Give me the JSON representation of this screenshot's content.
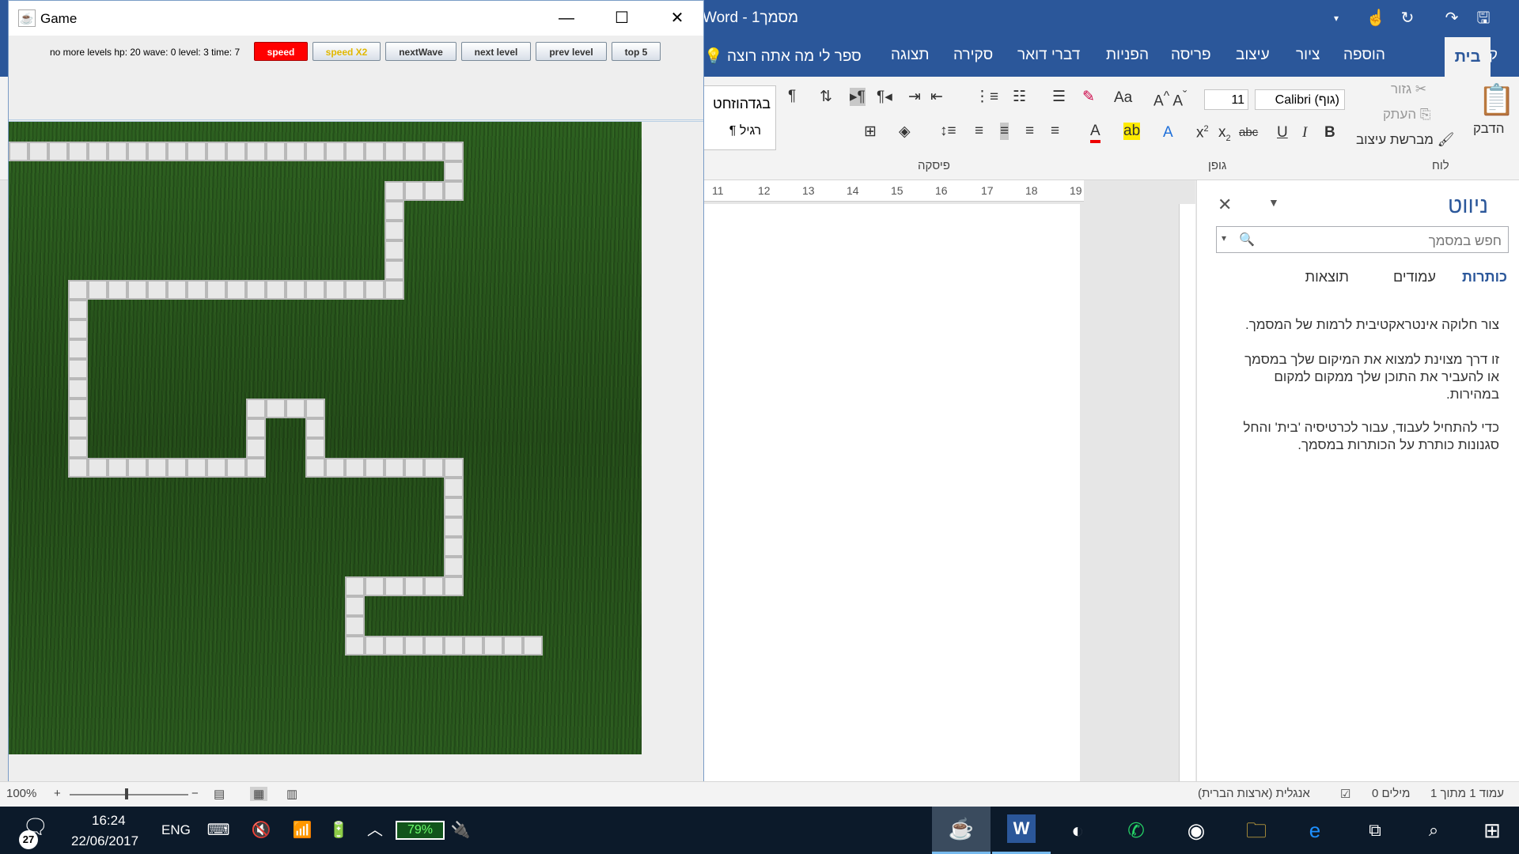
{
  "word": {
    "title": "Word - מסמך1",
    "quick_access": [
      "save-icon",
      "redo-icon",
      "refresh-icon",
      "touch-icon",
      "dropdown-icon"
    ],
    "tabs": [
      "קובץ",
      "בית",
      "הוספה",
      "ציור",
      "עיצוב",
      "פריסה",
      "הפניות",
      "דברי דואר",
      "סקירה",
      "תצוגה"
    ],
    "tell_me": "ספר לי מה אתה רוצה",
    "ribbon": {
      "clipboard_label": "לוח",
      "paste_label": "הדבק",
      "cut_label": "גזור",
      "copy_label": "העתק",
      "format_painter_label": "מברשת עיצוב",
      "font_label": "גופן",
      "font_name": "Calibri (גוף)",
      "font_size": "11",
      "paragraph_label": "פיסקה",
      "style_heading": "בגדהוזחט",
      "style_normal": "¶ רגיל"
    },
    "ruler_numbers": [
      "11",
      "12",
      "13",
      "14",
      "15",
      "16",
      "17",
      "18",
      "19"
    ],
    "nav_pane": {
      "title": "ניווט",
      "search_placeholder": "חפש במסמך",
      "tabs": [
        "כותרות",
        "עמודים",
        "תוצאות"
      ],
      "paragraphs": [
        "צור חלוקה אינטראקטיבית לרמות של המסמך.",
        "זו דרך מצוינת למצוא את המיקום שלך במסמך או להעביר את התוכן שלך ממקום למקום במהירות.",
        "כדי להתחיל לעבוד, עבור לכרטיסיה 'בית' והחל סגנונות כותרת על הכותרות במסמך."
      ]
    },
    "status": {
      "page": "עמוד 1 מתוך 1",
      "words": "0 מילים",
      "language": "אנגלית (ארצות הברית)",
      "zoom": "100%"
    }
  },
  "taskbar": {
    "notifications": "27",
    "time": "16:24",
    "date": "22/06/2017",
    "lang": "ENG",
    "battery": "79%"
  },
  "game": {
    "title": "Game",
    "status_text": "no more levels  hp: 20  wave: 0  level: 3  time: 7",
    "buttons": {
      "speed": "speed",
      "speed_x2": "speed X2",
      "next_wave": "nextWave",
      "next_level": "next level",
      "prev_level": "prev level",
      "top5": "top 5"
    },
    "colors": {
      "grass": "#2b5a1c",
      "path_tile": "#e8e8e8",
      "speed_button": "#ff0000"
    },
    "path_tiles_count": 127
  }
}
